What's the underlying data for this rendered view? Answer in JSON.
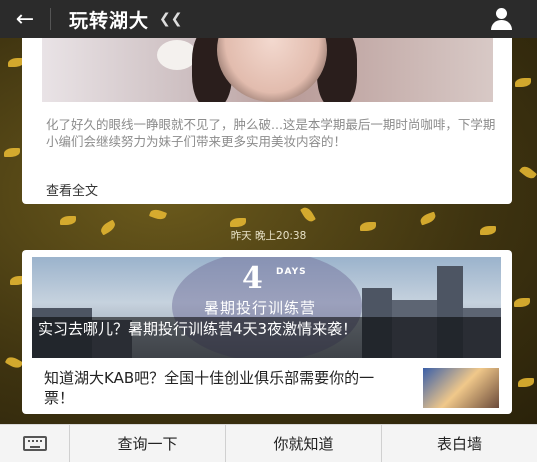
{
  "header": {
    "back_icon": "back-arrow-icon",
    "title": "玩转湖大",
    "title_icon": "voice-icon",
    "profile_icon": "person-icon"
  },
  "article1": {
    "excerpt": "化了好久的眼线一睁眼就不见了，肿么破...这是本学期最后一期时尚咖啡，下学期小编们会继续努力为妹子们带来更多实用美妆内容的！",
    "read_more": "查看全文"
  },
  "timestamp": "昨天 晚上20:38",
  "article2": {
    "banner_number": "4",
    "banner_days": "DAYS",
    "banner_subtitle": "暑期投行训练营",
    "banner_caption": "实习去哪儿？暑期投行训练营4天3夜激情来袭！",
    "item_title": "知道湖大KAB吧？全国十佳创业俱乐部需要你的一票！"
  },
  "menu": {
    "keyboard_icon": "keyboard-icon",
    "items": [
      "查询一下",
      "你就知道",
      "表白墙"
    ]
  },
  "colors": {
    "header_bg": "#2b2b2b",
    "menu_bg": "#f4f4f4",
    "leaf": "#e2b531"
  }
}
